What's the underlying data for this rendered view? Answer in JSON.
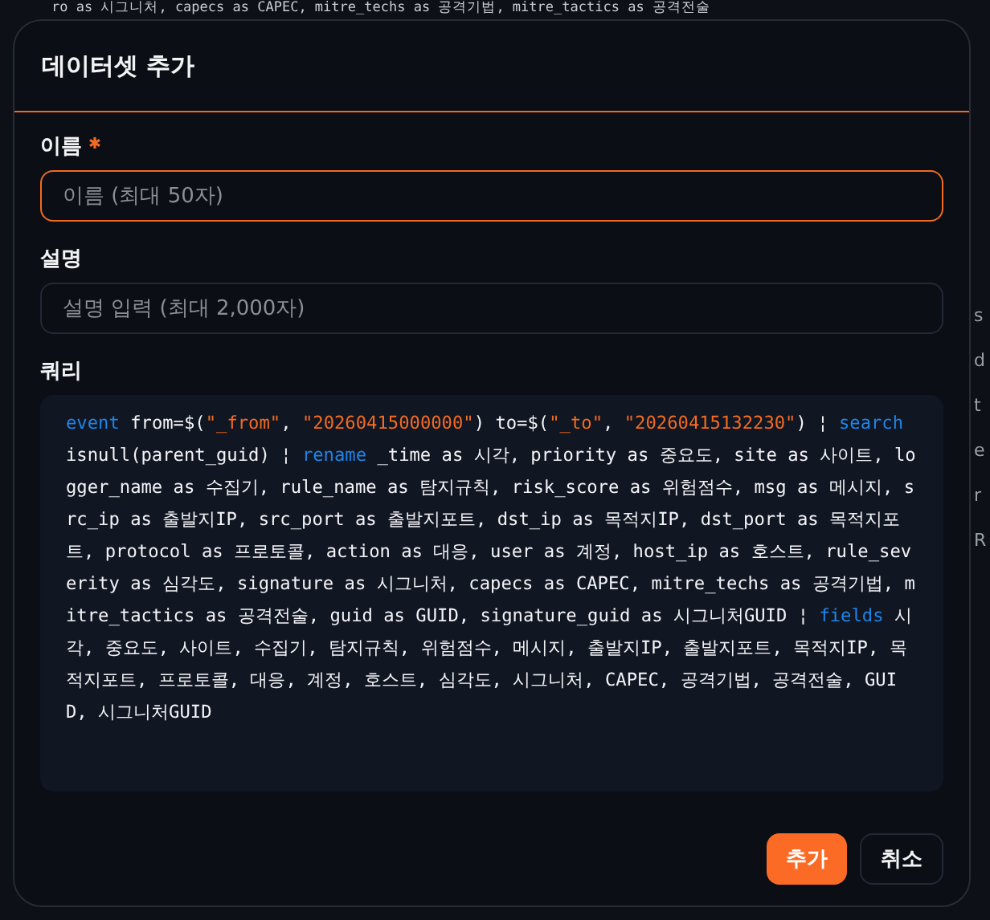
{
  "background": {
    "code_line": "ro as 시그니처, capecs as CAPEC, mitre_techs as 공격기법, mitre_tactics as 공격전술",
    "edge_fragments": [
      "s",
      "d",
      "t",
      "e",
      "r",
      "R"
    ]
  },
  "dialog": {
    "title": "데이터셋 추가",
    "fields": [
      {
        "label": "이름",
        "required": true,
        "placeholder": "이름 (최대 50자)",
        "focused": true
      },
      {
        "label": "설명",
        "placeholder": "설명 입력 (최대 2,000자)",
        "focused": false
      }
    ],
    "query": {
      "label": "쿼리",
      "tokens": [
        {
          "kind": "keyword",
          "text": "event"
        },
        {
          "kind": "plain",
          "text": " from=$("
        },
        {
          "kind": "string",
          "text": "\"_from\""
        },
        {
          "kind": "plain",
          "text": ", "
        },
        {
          "kind": "string",
          "text": "\"20260415000000\""
        },
        {
          "kind": "plain",
          "text": ") to=$("
        },
        {
          "kind": "string",
          "text": "\"_to\""
        },
        {
          "kind": "plain",
          "text": ", "
        },
        {
          "kind": "string",
          "text": "\"20260415132230\""
        },
        {
          "kind": "plain",
          "text": ") ¦ "
        },
        {
          "kind": "keyword",
          "text": "search"
        },
        {
          "kind": "plain",
          "text": " isnull(parent_guid) ¦ "
        },
        {
          "kind": "keyword",
          "text": "rename"
        },
        {
          "kind": "plain",
          "text": " _time as 시각, priority as 중요도, site as 사이트, logger_name as 수집기, rule_name as 탐지규칙, risk_score as 위험점수, msg as 메시지, src_ip as 출발지IP, src_port as 출발지포트, dst_ip as 목적지IP, dst_port as 목적지포트, protocol as 프로토콜, action as 대응, user as 계정, host_ip as 호스트, rule_severity as 심각도, signature as 시그니처, capecs as CAPEC, mitre_techs as 공격기법, mitre_tactics as 공격전술, guid as GUID, signature_guid as 시그니처GUID ¦ "
        },
        {
          "kind": "keyword",
          "text": "fields"
        },
        {
          "kind": "plain",
          "text": " 시각, 중요도, 사이트, 수집기, 탐지규칙, 위험점수, 메시지, 출발지IP, 출발지포트, 목적지IP, 목적지포트, 프로토콜, 대응, 계정, 호스트, 심각도, 시그니처, CAPEC, 공격기법, 공격전술, GUID, 시그니처GUID"
        }
      ]
    },
    "buttons": [
      {
        "label": "추가",
        "kind": "primary"
      },
      {
        "label": "취소",
        "kind": "secondary"
      }
    ]
  }
}
